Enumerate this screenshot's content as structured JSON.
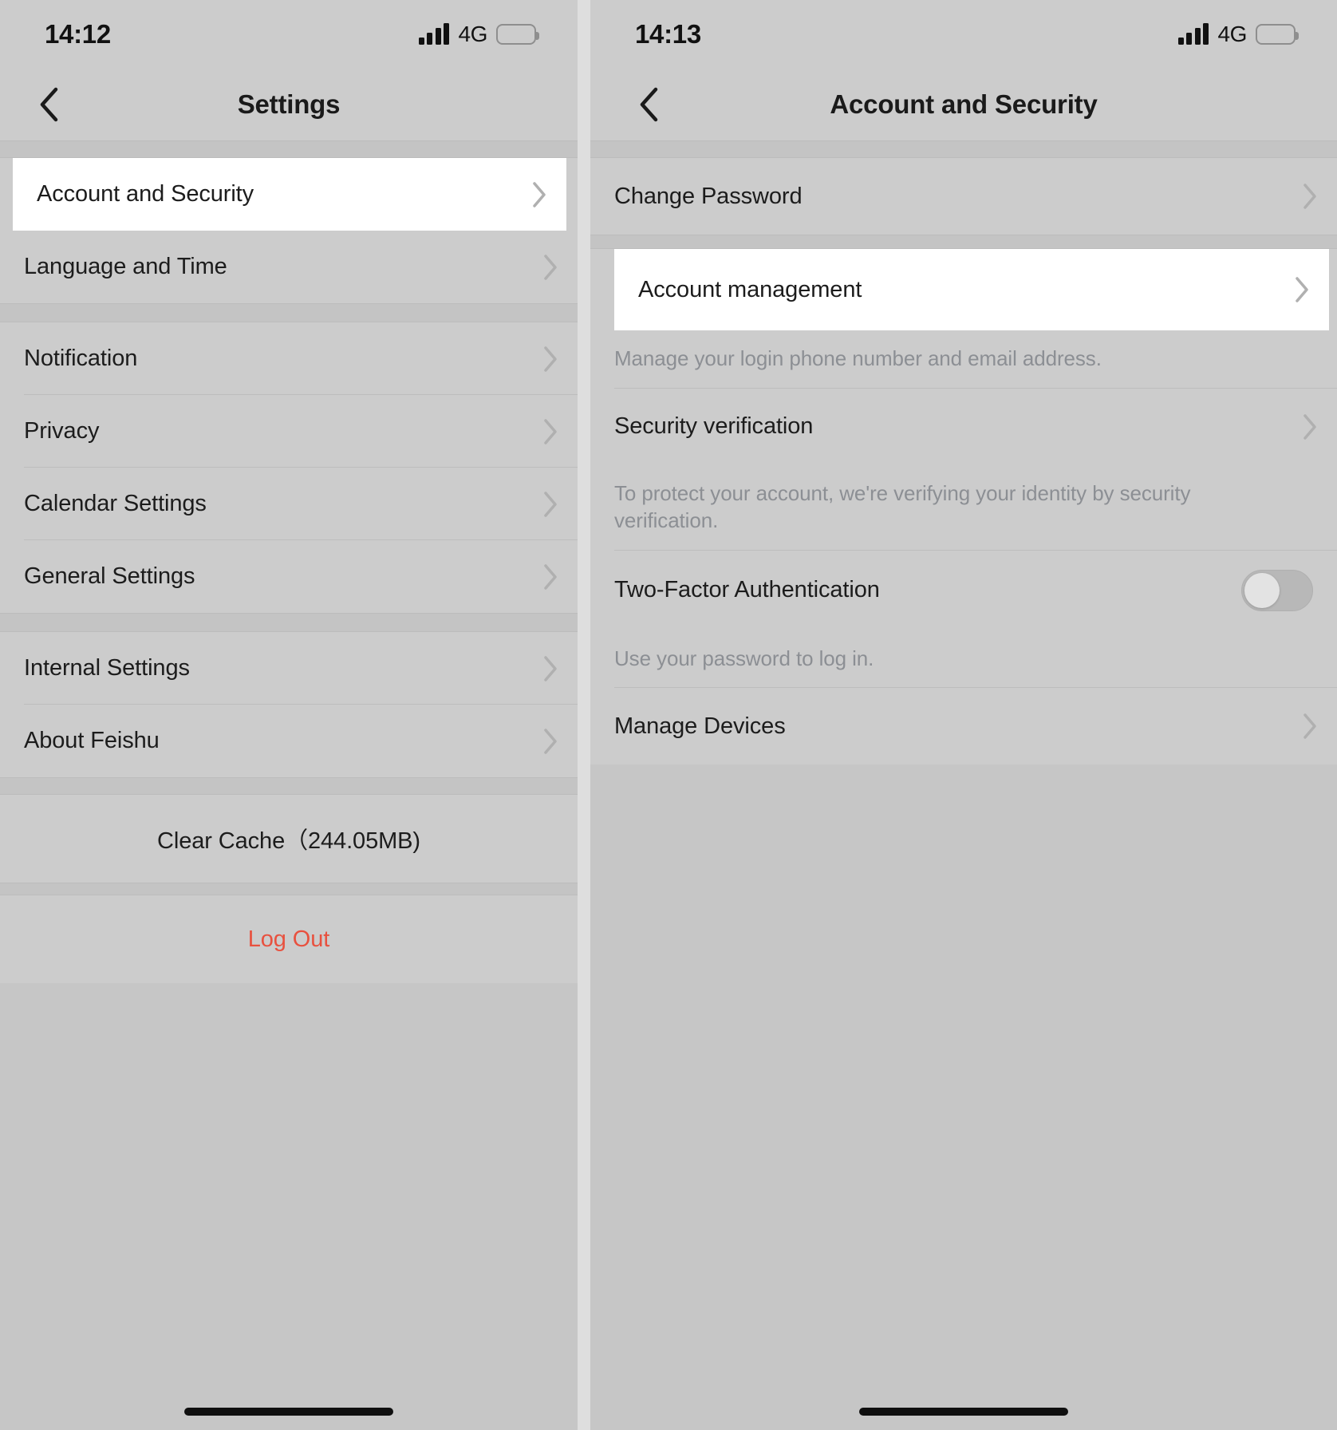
{
  "screens": [
    {
      "id": "settings",
      "status": {
        "time": "14:12",
        "network": "4G",
        "signal_bars": 4,
        "battery_level": "low-power"
      },
      "nav": {
        "back_icon": "chevron-left-icon",
        "title": "Settings"
      },
      "groups": [
        {
          "rows": [
            {
              "label": "Account and Security",
              "chevron": "chevron-right-icon",
              "highlighted": true
            },
            {
              "label": "Language and Time",
              "chevron": "chevron-right-icon",
              "highlighted": false
            }
          ]
        },
        {
          "rows": [
            {
              "label": "Notification",
              "chevron": "chevron-right-icon",
              "highlighted": false
            },
            {
              "label": "Privacy",
              "chevron": "chevron-right-icon",
              "highlighted": false
            },
            {
              "label": "Calendar Settings",
              "chevron": "chevron-right-icon",
              "highlighted": false
            },
            {
              "label": "General Settings",
              "chevron": "chevron-right-icon",
              "highlighted": false
            }
          ]
        },
        {
          "rows": [
            {
              "label": "Internal Settings",
              "chevron": "chevron-right-icon",
              "highlighted": false
            },
            {
              "label": "About Feishu",
              "chevron": "chevron-right-icon",
              "highlighted": false
            }
          ]
        }
      ],
      "clear_cache": {
        "label": "Clear Cache（244.05MB)",
        "size": "244.05MB"
      },
      "log_out": {
        "label": "Log Out",
        "color": "#e8513f"
      }
    },
    {
      "id": "account-and-security",
      "status": {
        "time": "14:13",
        "network": "4G",
        "signal_bars": 4,
        "battery_level": "low-power"
      },
      "nav": {
        "back_icon": "chevron-left-icon",
        "title": "Account and Security"
      },
      "rows": [
        {
          "label": "Change Password",
          "chevron": "chevron-right-icon",
          "highlighted": false,
          "description": null
        },
        {
          "label": "Account management",
          "chevron": "chevron-right-icon",
          "highlighted": true,
          "description": "Manage your login phone number and email address."
        },
        {
          "label": "Security verification",
          "chevron": "chevron-right-icon",
          "highlighted": false,
          "description": "To protect your account, we're verifying your identity by security verification."
        },
        {
          "label": "Two-Factor Authentication",
          "control": "toggle",
          "toggle_on": false,
          "highlighted": false,
          "description": "Use your password to log in."
        },
        {
          "label": "Manage Devices",
          "chevron": "chevron-right-icon",
          "highlighted": false,
          "description": null
        }
      ]
    }
  ]
}
